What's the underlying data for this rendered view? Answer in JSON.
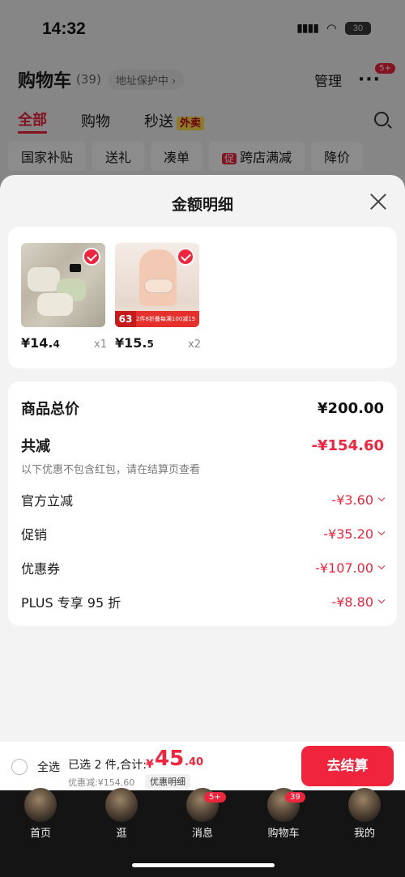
{
  "status_bar": {
    "time": "14:32",
    "battery": "30"
  },
  "background_page": {
    "title": "购物车",
    "count": "(39)",
    "address_protect": "地址保护中 ›",
    "manage": "管理",
    "more_badge": "5+",
    "tabs": [
      "全部",
      "购物",
      "秒送"
    ],
    "takeaway_badge": "外卖",
    "chips": [
      "国家补贴",
      "送礼",
      "凑单",
      "跨店满减",
      "降价"
    ],
    "chip_promo_badge": "促"
  },
  "sheet": {
    "title": "金额明细",
    "products": [
      {
        "price_int": "¥14.",
        "price_dec": "4",
        "qty": "x1"
      },
      {
        "price_int": "¥15.",
        "price_dec": "5",
        "qty": "x2",
        "promo_num": "63",
        "promo_text": "2件8折叠每满100减15"
      }
    ],
    "summary": {
      "total_label": "商品总价",
      "total_value": "¥200.00",
      "reduce_label": "共减",
      "reduce_value": "-¥154.60",
      "note": "以下优惠不包含红包，请在结算页查看",
      "items": [
        {
          "label": "官方立减",
          "value": "-¥3.60"
        },
        {
          "label": "促销",
          "value": "-¥35.20"
        },
        {
          "label": "优惠券",
          "value": "-¥107.00"
        },
        {
          "label": "PLUS 专享 95 折",
          "value": "-¥8.80"
        }
      ]
    }
  },
  "checkout": {
    "select_all": "全选",
    "selected_text": "已选 2 件,合计:",
    "currency": "¥",
    "total_int": "45",
    "total_dec": ".40",
    "discount_text": "优惠减:¥154.60",
    "detail_link": "优惠明细",
    "button": "去结算"
  },
  "tabbar": {
    "items": [
      {
        "label": "首页"
      },
      {
        "label": "逛"
      },
      {
        "label": "消息",
        "badge": "5+"
      },
      {
        "label": "购物车",
        "badge": "39"
      },
      {
        "label": "我的"
      }
    ]
  },
  "colors": {
    "accent": "#f0243c",
    "tabbar_bg": "#141414",
    "sheet_bg": "#f3f3f3"
  }
}
